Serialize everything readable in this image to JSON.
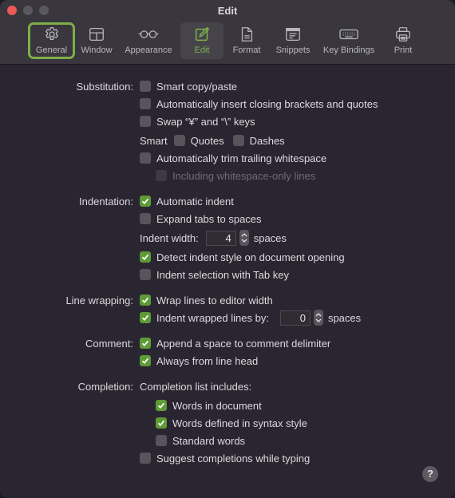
{
  "window": {
    "title": "Edit"
  },
  "toolbar": {
    "items": [
      {
        "label": "General",
        "icon": "gear-icon"
      },
      {
        "label": "Window",
        "icon": "window-icon"
      },
      {
        "label": "Appearance",
        "icon": "glasses-icon"
      },
      {
        "label": "Edit",
        "icon": "edit-icon"
      },
      {
        "label": "Format",
        "icon": "document-icon"
      },
      {
        "label": "Snippets",
        "icon": "snippets-icon"
      },
      {
        "label": "Key Bindings",
        "icon": "keyboard-icon"
      },
      {
        "label": "Print",
        "icon": "printer-icon"
      }
    ],
    "selected": "Edit",
    "focused": "General"
  },
  "accent_color": "#7fb24a",
  "substitution": {
    "label": "Substitution:",
    "smart_copy_paste": {
      "label": "Smart copy/paste",
      "checked": false
    },
    "auto_close_brackets": {
      "label": "Automatically insert closing brackets and quotes",
      "checked": false
    },
    "swap_yen": {
      "label": "Swap “¥” and “\\” keys",
      "checked": false
    },
    "smart_label": "Smart",
    "smart_quotes": {
      "label": "Quotes",
      "checked": false
    },
    "smart_dashes": {
      "label": "Dashes",
      "checked": false
    },
    "trim_whitespace": {
      "label": "Automatically trim trailing whitespace",
      "checked": false
    },
    "including_whitespace_only": {
      "label": "Including whitespace-only lines",
      "checked": false,
      "enabled": false
    }
  },
  "indentation": {
    "label": "Indentation:",
    "automatic_indent": {
      "label": "Automatic indent",
      "checked": true
    },
    "expand_tabs": {
      "label": "Expand tabs to spaces",
      "checked": false
    },
    "indent_width_label": "Indent width:",
    "indent_width_value": "4",
    "indent_width_unit": "spaces",
    "detect_indent_style": {
      "label": "Detect indent style on document opening",
      "checked": true
    },
    "indent_selection_tab": {
      "label": "Indent selection with Tab key",
      "checked": false
    }
  },
  "line_wrapping": {
    "label": "Line wrapping:",
    "wrap_lines": {
      "label": "Wrap lines to editor width",
      "checked": true
    },
    "indent_wrapped": {
      "label": "Indent wrapped lines by:",
      "checked": true
    },
    "indent_wrapped_value": "0",
    "indent_wrapped_unit": "spaces"
  },
  "comment": {
    "label": "Comment:",
    "append_space": {
      "label": "Append a space to comment delimiter",
      "checked": true
    },
    "from_line_head": {
      "label": "Always from line head",
      "checked": true
    }
  },
  "completion": {
    "label": "Completion:",
    "list_label": "Completion list includes:",
    "words_in_document": {
      "label": "Words in document",
      "checked": true
    },
    "words_in_syntax": {
      "label": "Words defined in syntax style",
      "checked": true
    },
    "standard_words": {
      "label": "Standard words",
      "checked": false
    },
    "suggest_while_typing": {
      "label": "Suggest completions while typing",
      "checked": false
    }
  },
  "help_button": {
    "label": "?"
  }
}
